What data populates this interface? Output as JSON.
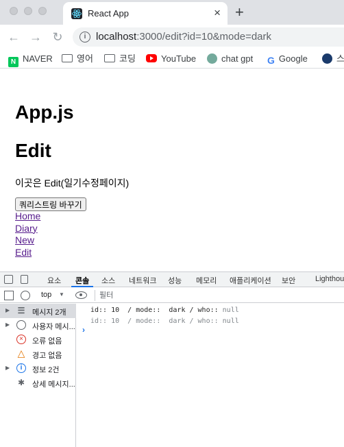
{
  "browser": {
    "tab_title": "React App",
    "tab_close": "×",
    "new_tab": "+",
    "url_host": "localhost",
    "url_rest": ":3000/edit?id=10&mode=dark",
    "bookmarks": [
      {
        "label": "NAVER",
        "icon": "naver-icon"
      },
      {
        "label": "영어",
        "icon": "folder-icon"
      },
      {
        "label": "코딩",
        "icon": "folder-icon"
      },
      {
        "label": "YouTube",
        "icon": "youtube-icon"
      },
      {
        "label": "chat gpt",
        "icon": "chatgpt-icon"
      },
      {
        "label": "Google",
        "icon": "google-icon"
      },
      {
        "label": "스",
        "icon": "avatar-icon"
      }
    ]
  },
  "page": {
    "app_heading": "App.js",
    "edit_heading": "Edit",
    "description": "이곳은 Edit(일기수정페이지)",
    "querystring_button": "쿼리스트링 바꾸기",
    "links": [
      "Home",
      "Diary",
      "New",
      "Edit"
    ]
  },
  "devtools": {
    "tabs": [
      "요소",
      "콘솔",
      "소스",
      "네트워크",
      "성능",
      "메모리",
      "애플리케이션",
      "보안",
      "Lighthouse"
    ],
    "active_tab": "콘솔",
    "context": "top",
    "filter_placeholder": "필터",
    "sidebar": [
      {
        "label": "메시지 2개",
        "icon": "list-icon",
        "expandable": true,
        "selected": true
      },
      {
        "label": "사용자 메시...",
        "icon": "user-icon",
        "expandable": true,
        "selected": false
      },
      {
        "label": "오류 없음",
        "icon": "error-icon",
        "expandable": false,
        "selected": false
      },
      {
        "label": "경고 없음",
        "icon": "warning-icon",
        "expandable": false,
        "selected": false
      },
      {
        "label": "정보 2건",
        "icon": "info-icon",
        "expandable": true,
        "selected": false
      },
      {
        "label": "상세 메시지...",
        "icon": "bug-icon",
        "expandable": false,
        "selected": false
      }
    ],
    "logs": [
      {
        "text": "id:: 10  / mode::  dark / who:: ",
        "null": "null"
      },
      {
        "text": "id:: 10  / mode::  dark / who:: ",
        "null": "null"
      }
    ],
    "prompt": "›"
  }
}
